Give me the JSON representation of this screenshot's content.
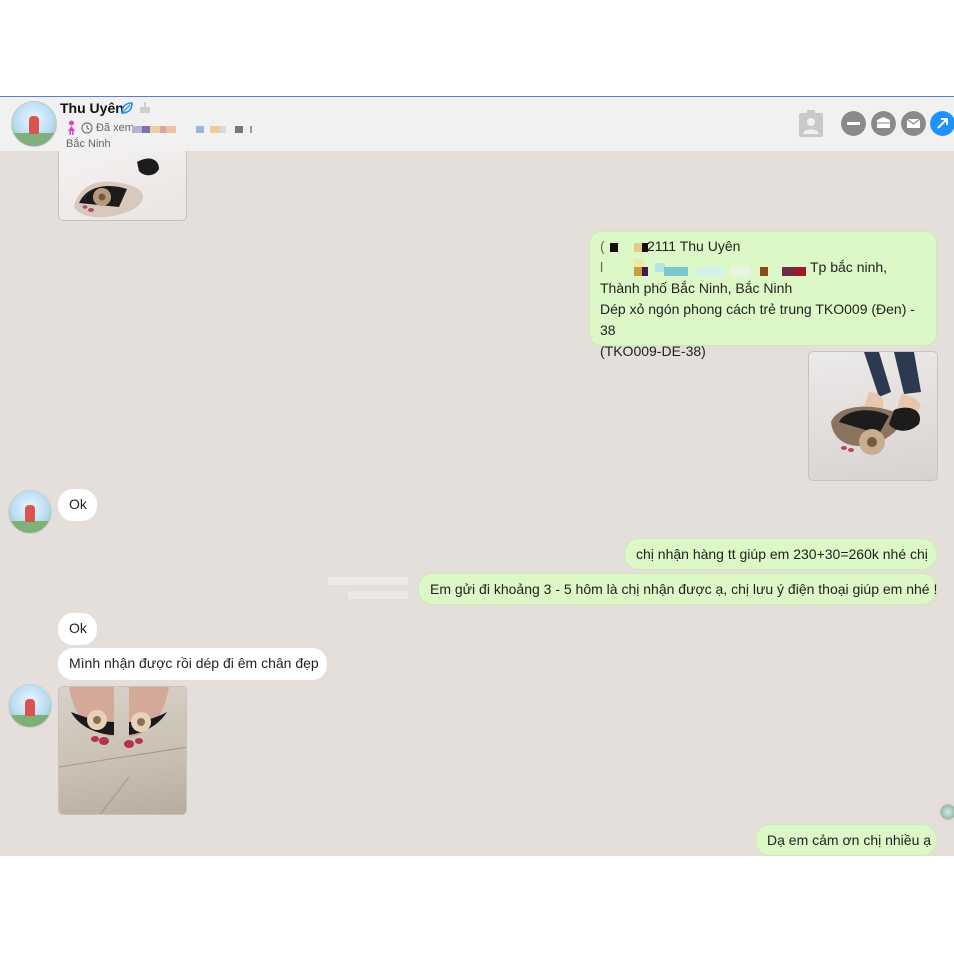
{
  "header": {
    "name": "Thu Uyên",
    "seen_label": "Đã xem",
    "location": "Bắc Ninh"
  },
  "icons": {
    "verified": "leaf-icon",
    "birthday": "cake-icon",
    "gender": "female-icon",
    "seen": "clock-icon",
    "contact": "contact-card-icon",
    "minimize": "minus-icon",
    "tag": "tag-icon",
    "mail": "mail-icon",
    "popout": "arrow-up-right-icon"
  },
  "colors": {
    "accent": "#1e90ff",
    "outgoing_bubble": "#dcf8c6",
    "incoming_bubble": "#ffffff",
    "chat_background": "#e4dfda",
    "header_border": "#5b7fc7"
  },
  "messages": {
    "order_line1": "2111 Thu Uyên",
    "order_line2_suffix": "Tp bắc ninh,",
    "order_line3": "Thành phố Bắc Ninh, Bắc Ninh",
    "order_line4": "Dép xỏ ngón phong cách trẻ trung TKO009 (Đen) - 38",
    "order_line5": "(TKO009-DE-38)",
    "reply_ok_1": "Ok",
    "payment": "chị nhận hàng tt giúp em 230+30=260k nhé chị",
    "shipping": "Em gửi đi khoảng 3 - 5 hôm là chị nhận được ạ, chị lưu ý điện thoại giúp em nhé !",
    "reply_ok_2": "Ok",
    "received": "Mình nhận được rồi dép đi êm chân đẹp",
    "thanks": "Dạ em cảm ơn chị nhiều ạ"
  }
}
